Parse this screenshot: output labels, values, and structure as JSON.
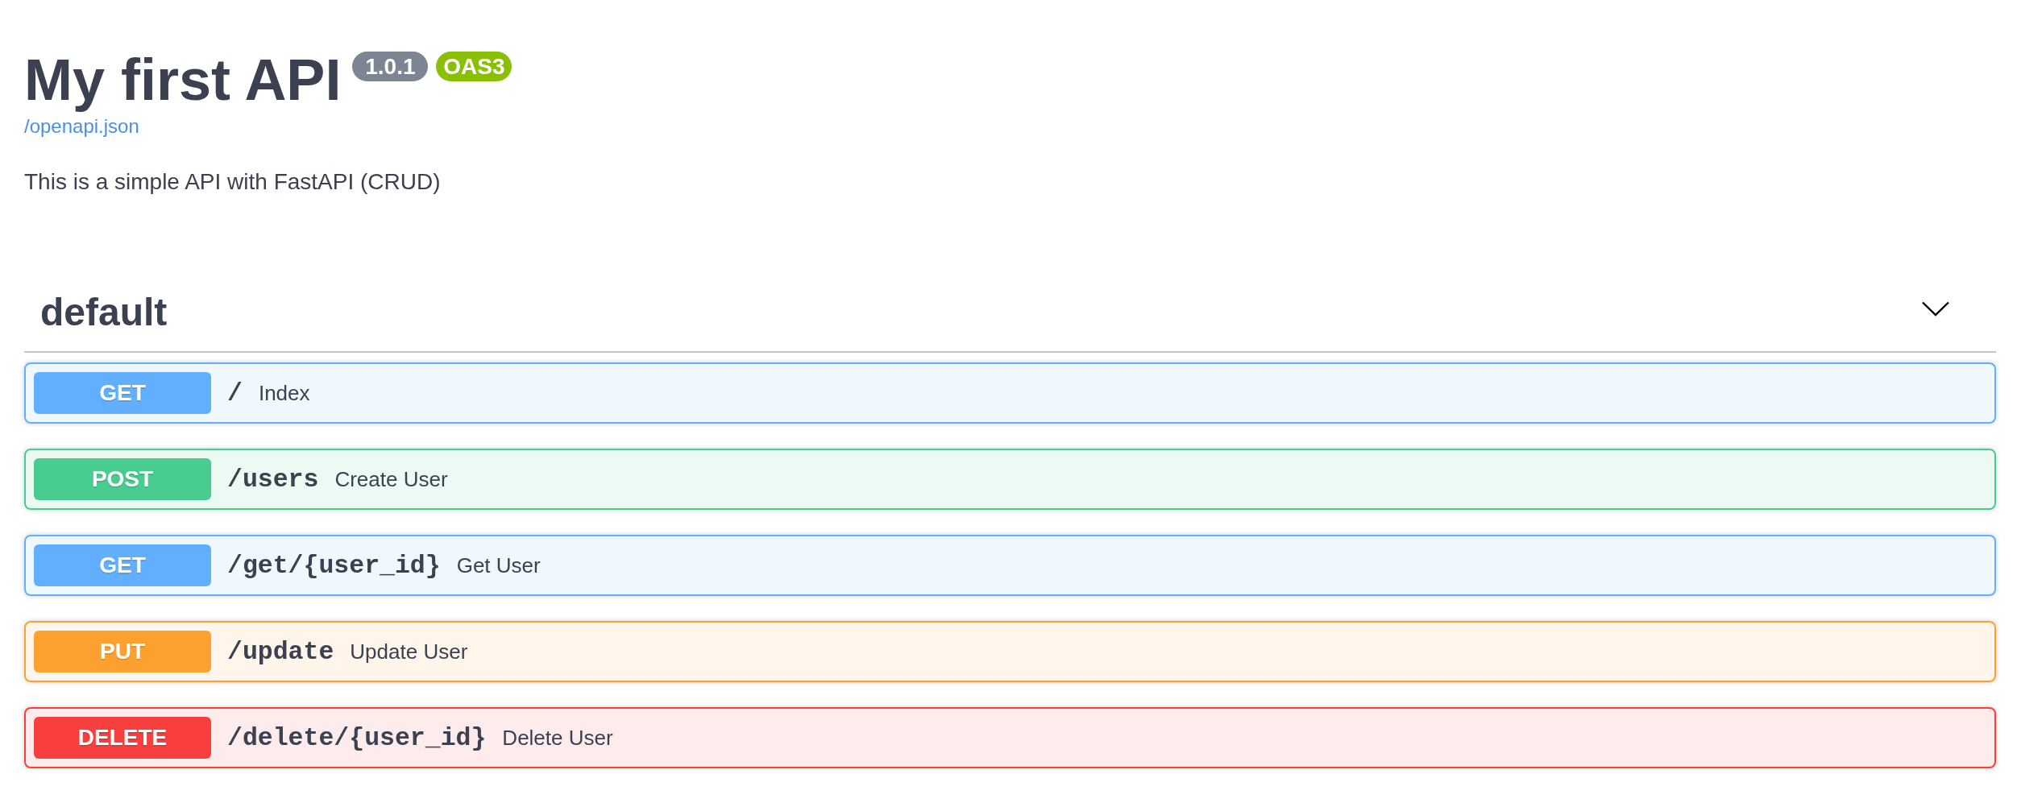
{
  "info": {
    "title": "My first API",
    "badges": [
      {
        "text": "1.0.1",
        "color": "#7d8492"
      },
      {
        "text": "OAS3",
        "color": "#89bf04"
      }
    ],
    "link": "/openapi.json",
    "description": "This is a simple API with FastAPI (CRUD)"
  },
  "tag": {
    "name": "default",
    "expanded": true
  },
  "operations": [
    {
      "kind": "get",
      "method": "GET",
      "path": "/",
      "summary": "Index"
    },
    {
      "kind": "post",
      "method": "POST",
      "path": "/users",
      "summary": "Create User"
    },
    {
      "kind": "get",
      "method": "GET",
      "path": "/get/{user_id}",
      "summary": "Get User"
    },
    {
      "kind": "put",
      "method": "PUT",
      "path": "/update",
      "summary": "Update User"
    },
    {
      "kind": "delete",
      "method": "DELETE",
      "path": "/delete/{user_id}",
      "summary": "Delete User"
    }
  ]
}
